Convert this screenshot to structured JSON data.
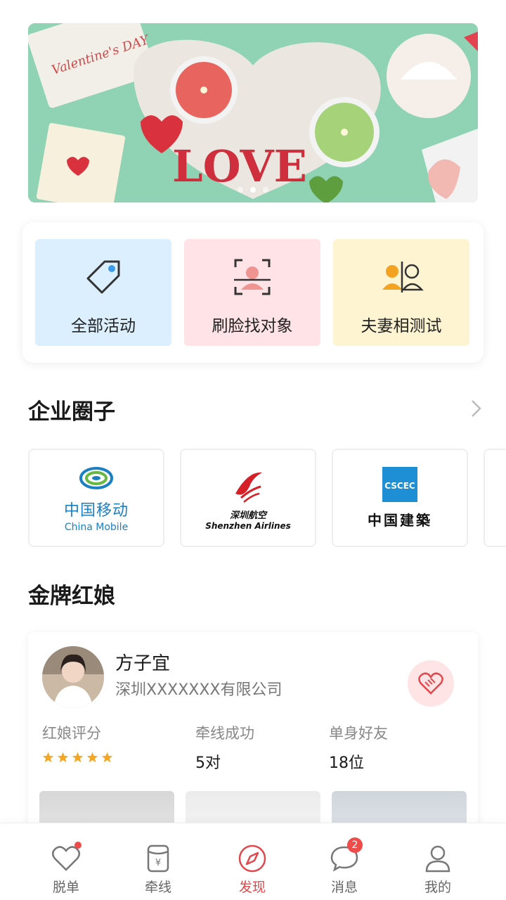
{
  "banner": {
    "art_text": "LOVE",
    "card_text": "Valentine's DAY",
    "slides": 3,
    "active_slide": 2
  },
  "quick_actions": [
    {
      "label": "全部活动",
      "icon": "tag-icon"
    },
    {
      "label": "刷脸找对象",
      "icon": "face-scan-icon"
    },
    {
      "label": "夫妻相测试",
      "icon": "couple-face-icon"
    }
  ],
  "enterprise": {
    "title": "企业圈子",
    "companies": [
      {
        "cn": "中国移动",
        "en": "China Mobile"
      },
      {
        "cn": "深圳航空",
        "en": "Shenzhen Airlines"
      },
      {
        "cn": "中国建築",
        "en": ""
      }
    ]
  },
  "matchmakers": {
    "title": "金牌红娘",
    "card": {
      "name": "方子宜",
      "company": "深圳XXXXXXX有限公司",
      "rating_label": "红娘评分",
      "rating_stars": 5,
      "matched_label": "牵线成功",
      "matched_value": "5对",
      "singles_label": "单身好友",
      "singles_value": "18位"
    }
  },
  "tabbar": {
    "items": [
      {
        "label": "脱单",
        "icon": "heart-icon",
        "dot": true
      },
      {
        "label": "牵线",
        "icon": "cup-icon"
      },
      {
        "label": "发现",
        "icon": "compass-icon",
        "active": true
      },
      {
        "label": "消息",
        "icon": "chat-icon",
        "badge": "2"
      },
      {
        "label": "我的",
        "icon": "user-icon"
      }
    ]
  },
  "colors": {
    "accent": "#e2474c",
    "banner_bg": "#8fd2b4",
    "tile_blue": "#dcefff",
    "tile_pink": "#ffe3e6",
    "tile_yellow": "#fff4d2"
  }
}
